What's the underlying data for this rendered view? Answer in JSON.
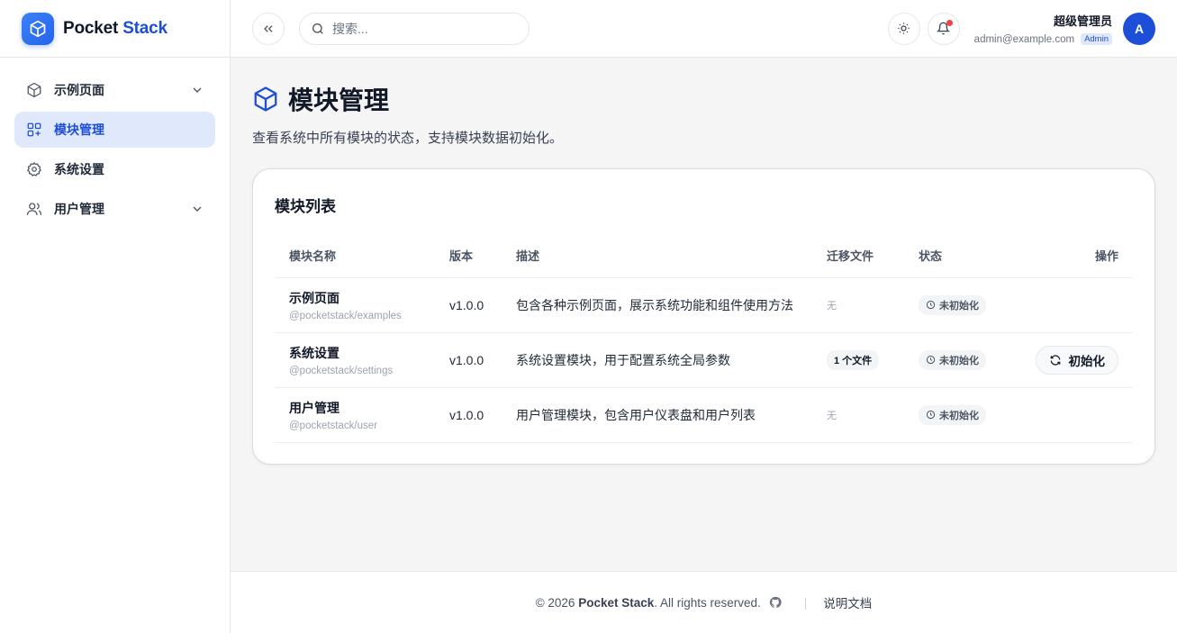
{
  "brand": {
    "name_part1": "Pocket",
    "name_part2": "Stack"
  },
  "sidebar": {
    "items": [
      {
        "label": "示例页面",
        "icon": "cube-icon",
        "has_children": true
      },
      {
        "label": "模块管理",
        "icon": "modules-icon",
        "active": true
      },
      {
        "label": "系统设置",
        "icon": "gear-icon"
      },
      {
        "label": "用户管理",
        "icon": "users-icon",
        "has_children": true
      }
    ]
  },
  "header": {
    "search_placeholder": "搜索...",
    "user": {
      "name": "超级管理员",
      "email": "admin@example.com",
      "role": "Admin",
      "avatar_letter": "A"
    }
  },
  "main": {
    "title": "模块管理",
    "description": "查看系统中所有模块的状态，支持模块数据初始化。",
    "card_title": "模块列表",
    "columns": [
      "模块名称",
      "版本",
      "描述",
      "迁移文件",
      "状态",
      "操作"
    ],
    "rows": [
      {
        "name": "示例页面",
        "package": "@pocketstack/examples",
        "version": "v1.0.0",
        "description": "包含各种示例页面，展示系统功能和组件使用方法",
        "migrations": "无",
        "status": "未初始化"
      },
      {
        "name": "系统设置",
        "package": "@pocketstack/settings",
        "version": "v1.0.0",
        "description": "系统设置模块，用于配置系统全局参数",
        "migrations": "1 个文件",
        "status": "未初始化",
        "action": "初始化"
      },
      {
        "name": "用户管理",
        "package": "@pocketstack/user",
        "version": "v1.0.0",
        "description": "用户管理模块，包含用户仪表盘和用户列表",
        "migrations": "无",
        "status": "未初始化"
      }
    ]
  },
  "footer": {
    "copyright_prefix": "© 2026",
    "brand": "Pocket Stack",
    "copyright_suffix": ". All rights reserved.",
    "docs_link": "说明文档"
  },
  "colors": {
    "accent": "#1d4ed8",
    "active_bg": "#e0e9fb",
    "notif": "#ef4444"
  }
}
